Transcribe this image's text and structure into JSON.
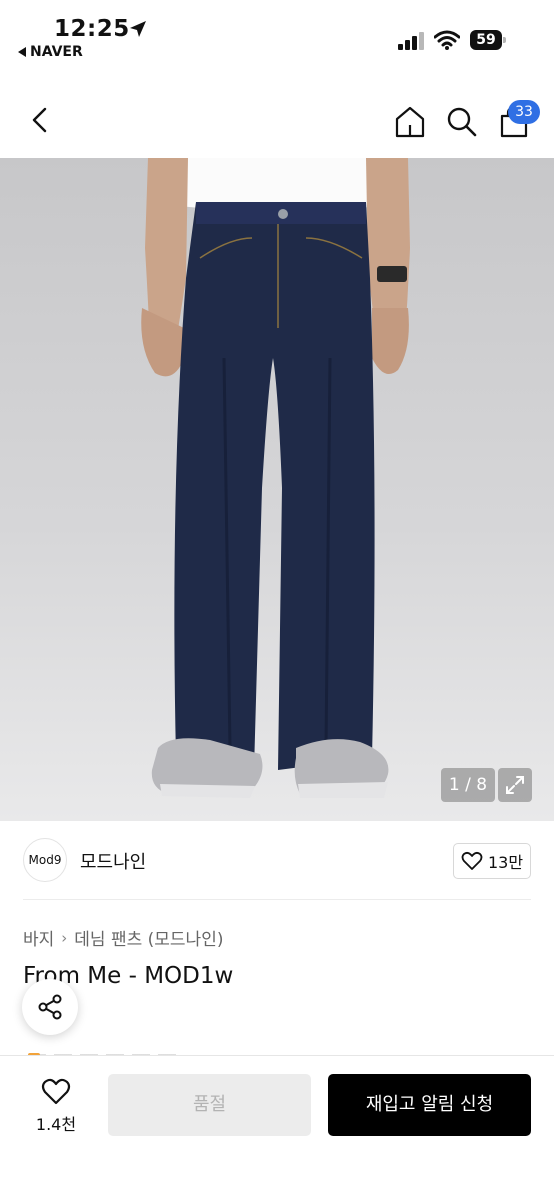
{
  "status_bar": {
    "time": "12:25",
    "back_app": "NAVER",
    "battery": "59"
  },
  "header": {
    "cart_count": "33"
  },
  "gallery": {
    "pager": "1 / 8"
  },
  "brand": {
    "logo_text": "Mod9",
    "name": "모드나인",
    "likes": "13만"
  },
  "product": {
    "breadcrumb": [
      "바지",
      "데님 팬츠 (모드나인)"
    ],
    "title": "From Me - MOD1w"
  },
  "bottom_bar": {
    "wish_count": "1.4천",
    "soldout_label": "품절",
    "restock_label": "재입고 알림 신청"
  },
  "colors": {
    "badge": "#2f6fe4",
    "primary_button": "#000000",
    "disabled_button": "#ececec"
  },
  "icons": [
    "location-arrow-icon",
    "signal-icon",
    "wifi-icon",
    "battery-icon",
    "chevron-left-icon",
    "home-icon",
    "search-icon",
    "bag-icon",
    "expand-icon",
    "heart-icon",
    "share-icon"
  ]
}
